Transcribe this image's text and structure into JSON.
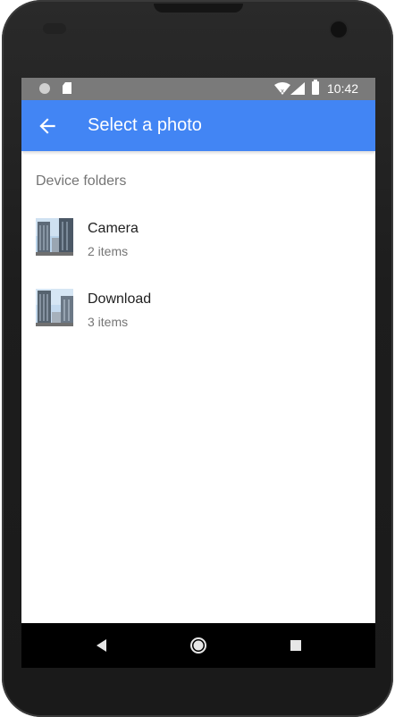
{
  "status_bar": {
    "time": "10:42"
  },
  "app_bar": {
    "title": "Select a photo",
    "back_icon": "arrow-left-icon"
  },
  "section": {
    "header": "Device folders"
  },
  "folders": [
    {
      "name": "Camera",
      "count": "2 items"
    },
    {
      "name": "Download",
      "count": "3 items"
    }
  ],
  "nav_bar": {
    "back_icon": "triangle-back-icon",
    "home_icon": "circle-home-icon",
    "recents_icon": "square-recents-icon"
  },
  "colors": {
    "app_bar": "#4285f4",
    "status_bar": "#7a7a7a",
    "secondary_text": "#757575",
    "primary_text": "#212121"
  }
}
